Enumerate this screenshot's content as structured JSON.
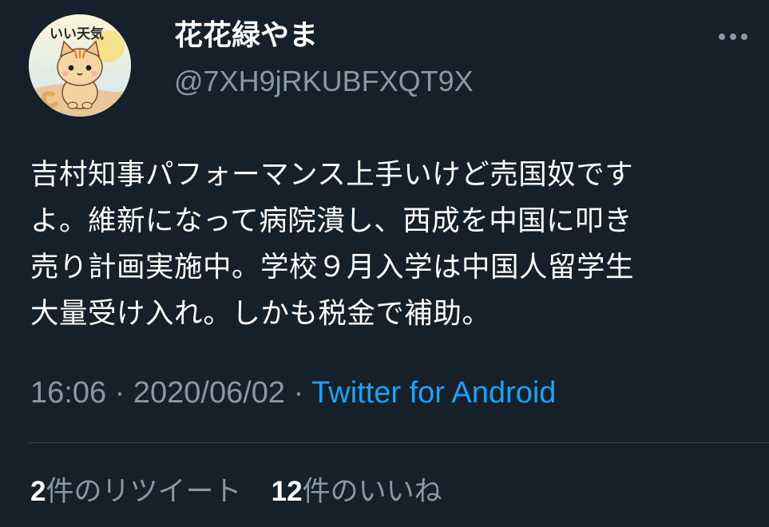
{
  "tweet": {
    "display_name": "花花緑やま",
    "handle": "@7XH9jRKUBFXQT9X",
    "avatar_text": "いい天気",
    "text": "吉村知事パフォーマンス上手いけど売国奴です\nよ。維新になって病院潰し、西成を中国に叩き\n売り計画実施中。学校９月入学は中国人留学生\n大量受け入れ。しかも税金で補助。",
    "time": "16:06",
    "sep1": " · ",
    "date": "2020/06/02",
    "sep2": " · ",
    "source": "Twitter for Android"
  },
  "stats": {
    "retweets_count": "2",
    "retweets_label": "件のリツイート",
    "likes_count": "12",
    "likes_label": "件のいいね"
  },
  "colors": {
    "background": "#15202b",
    "secondary_text": "#8899a6",
    "link": "#1da1f2"
  },
  "icons": {
    "more": "more-horizontal-icon"
  }
}
